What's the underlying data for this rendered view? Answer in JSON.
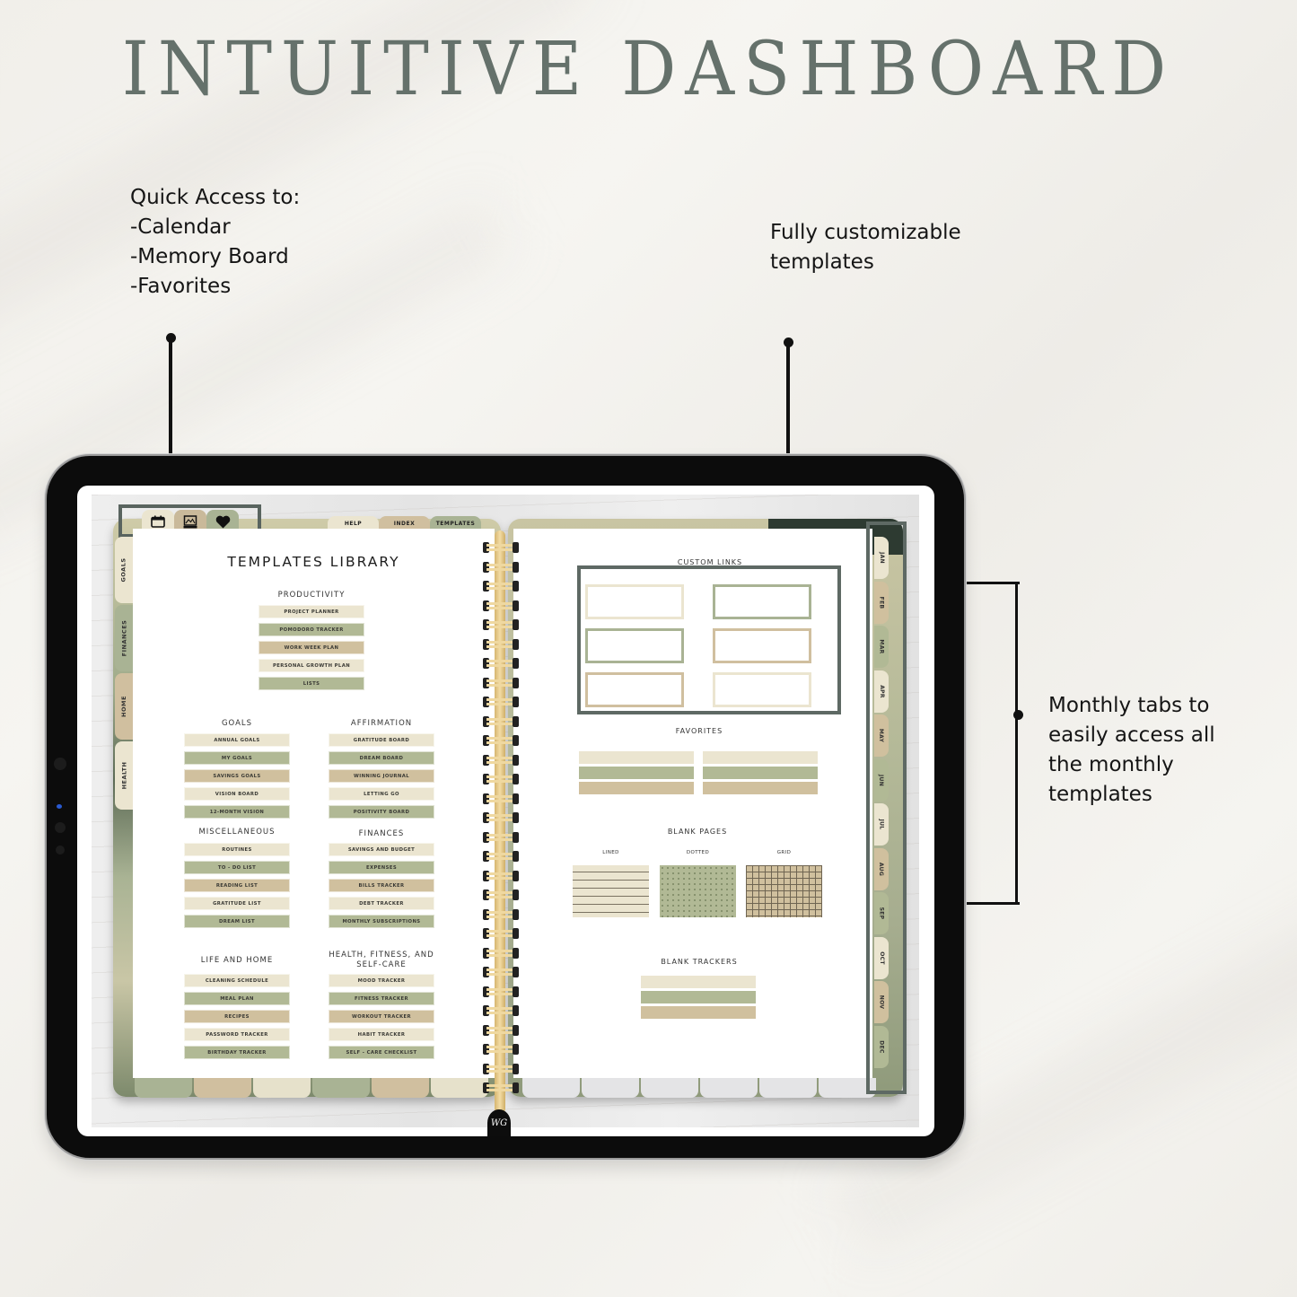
{
  "hero": {
    "title": "INTUITIVE DASHBOARD"
  },
  "callouts": {
    "quick_access": {
      "lines": [
        "Quick Access to:",
        "-Calendar",
        "-Memory Board",
        "-Favorites"
      ]
    },
    "customizable": {
      "lines": [
        "Fully customizable",
        "templates"
      ]
    },
    "monthly": {
      "lines": [
        "Monthly tabs to",
        "easily access all",
        "the monthly",
        "templates"
      ]
    }
  },
  "colors": {
    "cream": "#ebe5d0",
    "sage": "#b1b995",
    "tan": "#d0c09e",
    "frame": "#5e6964",
    "title": "#65716b"
  },
  "planner": {
    "quick_tabs": [
      {
        "icon": "calendar-icon",
        "label": "Calendar"
      },
      {
        "icon": "memory-board-icon",
        "label": "Memory Board"
      },
      {
        "icon": "heart-icon",
        "label": "Favorites"
      }
    ],
    "top_tabs": [
      "HELP",
      "INDEX",
      "TEMPLATES"
    ],
    "side_tabs": [
      "GOALS",
      "FINANCES",
      "HOME",
      "HEALTH"
    ],
    "month_tabs": [
      "JAN",
      "FEB",
      "MAR",
      "APR",
      "MAY",
      "JUN",
      "JUL",
      "AUG",
      "SEP",
      "OCT",
      "NOV",
      "DEC"
    ],
    "brand_mark": "WG",
    "left_page": {
      "title": "TEMPLATES LIBRARY",
      "sections": [
        {
          "id": "productivity",
          "title": "PRODUCTIVITY",
          "items": [
            "PROJECT PLANNER",
            "POMODORO TRACKER",
            "WORK WEEK PLAN",
            "PERSONAL GROWTH PLAN",
            "LISTS"
          ]
        },
        {
          "id": "goals",
          "title": "GOALS",
          "items": [
            "ANNUAL GOALS",
            "MY GOALS",
            "SAVINGS GOALS",
            "VISION BOARD",
            "12-MONTH VISION"
          ]
        },
        {
          "id": "affirmation",
          "title": "AFFIRMATION",
          "items": [
            "GRATITUDE BOARD",
            "DREAM BOARD",
            "WINNING JOURNAL",
            "LETTING GO",
            "POSITIVITY BOARD"
          ]
        },
        {
          "id": "miscellaneous",
          "title": "MISCELLANEOUS",
          "items": [
            "ROUTINES",
            "TO - DO LIST",
            "READING LIST",
            "GRATITUDE LIST",
            "DREAM LIST"
          ]
        },
        {
          "id": "finances",
          "title": "FINANCES",
          "items": [
            "SAVINGS AND BUDGET",
            "EXPENSES",
            "BILLS TRACKER",
            "DEBT TRACKER",
            "MONTHLY SUBSCRIPTIONS"
          ]
        },
        {
          "id": "life_home",
          "title": "LIFE AND HOME",
          "items": [
            "CLEANING SCHEDULE",
            "MEAL PLAN",
            "RECIPES",
            "PASSWORD TRACKER",
            "BIRTHDAY TRACKER"
          ]
        },
        {
          "id": "health",
          "title": "HEALTH, FITNESS, AND SELF-CARE",
          "items": [
            "MOOD TRACKER",
            "FITNESS TRACKER",
            "WORKOUT TRACKER",
            "HABIT TRACKER",
            "SELF - CARE CHECKLIST"
          ]
        }
      ]
    },
    "right_page": {
      "custom_links_title": "CUSTOM LINKS",
      "favorites_title": "FAVORITES",
      "blank_pages_title": "BLANK PAGES",
      "blank_pages": [
        "LINED",
        "DOTTED",
        "GRID"
      ],
      "blank_trackers_title": "BLANK TRACKERS"
    }
  }
}
